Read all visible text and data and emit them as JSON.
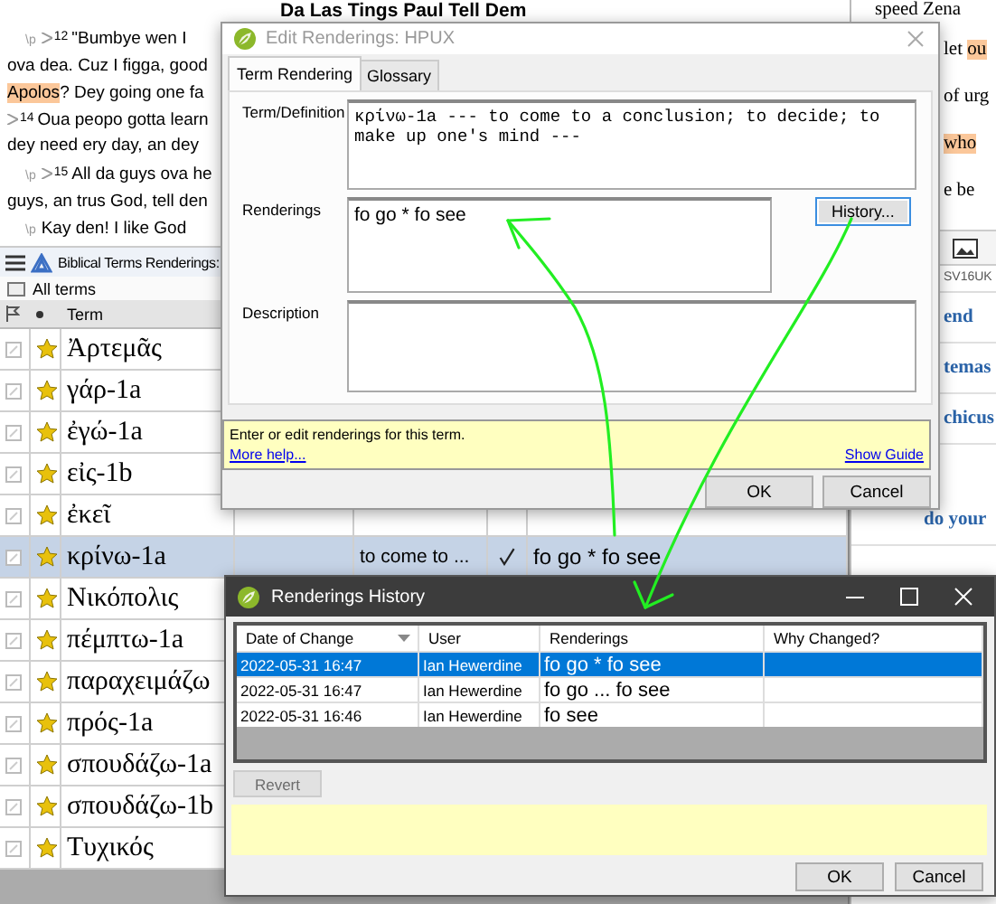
{
  "scripture": {
    "heading": "Da Las Tings Paul Tell Dem",
    "lines": [
      {
        "marker": "\\p",
        "verse": "12",
        "parts": [
          {
            "text": "\"Bumbye wen I",
            "highlight": false
          }
        ]
      },
      {
        "parts": [
          {
            "text": "ova dea. Cuz I figga, good",
            "highlight": false
          }
        ]
      },
      {
        "parts": [
          {
            "text": "Apolos",
            "highlight": true
          },
          {
            "text": "? Dey going one fa",
            "highlight": false
          }
        ]
      },
      {
        "verse": "14",
        "parts": [
          {
            "text": "Oua peopo gotta learn",
            "highlight": false
          }
        ]
      },
      {
        "parts": [
          {
            "text": "dey need ery day, an dey",
            "highlight": false
          }
        ]
      },
      {
        "marker": "\\p",
        "verse": "15",
        "parts": [
          {
            "text": "All da guys ova he",
            "highlight": false
          }
        ]
      },
      {
        "parts": [
          {
            "text": "guys, an trus God, tell den",
            "highlight": false
          }
        ]
      },
      {
        "marker": "\\p",
        "parts": [
          {
            "text": "Kay den! I like God",
            "highlight": false
          }
        ]
      }
    ]
  },
  "side_pane": {
    "lines": [
      {
        "parts": [
          {
            "text": "speed Zena",
            "highlight": false
          }
        ]
      },
      {
        "parts": [
          {
            "text": "let ",
            "highlight": false
          },
          {
            "text": "ou",
            "highlight": true
          }
        ]
      },
      {
        "parts": [
          {
            "text": "of urg",
            "highlight": false
          }
        ]
      },
      {
        "parts": [
          {
            "text": "who",
            "highlight": true
          }
        ]
      },
      {
        "parts": [
          {
            "text": "e be",
            "highlight": false
          }
        ]
      }
    ],
    "reference": "SV16UK",
    "links": [
      "end",
      "temas",
      "chicus",
      "do your"
    ]
  },
  "terms_panel": {
    "title": "Biblical Terms Renderings:",
    "filter": "All terms",
    "column_term": "Term",
    "rows": [
      {
        "term": "Ἀρτεμᾶς",
        "selected": false
      },
      {
        "term": "γάρ-1a",
        "selected": false
      },
      {
        "term": "ἐγώ-1a",
        "selected": false
      },
      {
        "term": "εἰς-1b",
        "selected": false
      },
      {
        "term": "ἐκεῖ",
        "selected": false
      },
      {
        "term": "κρίνω-1a",
        "selected": true,
        "gloss": "to come to ...",
        "checked": true,
        "renderings": "fo go * fo see"
      },
      {
        "term": "Νικόπολις",
        "selected": false
      },
      {
        "term": "πέμπτω-1a",
        "selected": false
      },
      {
        "term": "παραχειμάζω",
        "selected": false
      },
      {
        "term": "πρός-1a",
        "selected": false
      },
      {
        "term": "σπουδάζω-1a",
        "selected": false
      },
      {
        "term": "σπουδάζω-1b",
        "selected": false
      },
      {
        "term": "Τυχικός",
        "selected": false
      }
    ]
  },
  "edit_dialog": {
    "title": "Edit Renderings: HPUX",
    "tabs": [
      {
        "label": "Term Rendering",
        "selected": true
      },
      {
        "label": "Glossary",
        "selected": false
      }
    ],
    "term_label": "Term/Definition",
    "term_value": "κρίνω-1a --- to come to a conclusion; to decide; to make up one's mind ---",
    "renderings_label": "Renderings",
    "renderings_value": "fo go * fo see",
    "history_button": "History...",
    "description_label": "Description",
    "help_text": "Enter or edit renderings for this term.",
    "more_help": "More help...",
    "show_guide": "Show Guide",
    "buttons": [
      "OK",
      "Cancel"
    ]
  },
  "history_dialog": {
    "title": "Renderings History",
    "columns": [
      "Date of Change",
      "User",
      "Renderings",
      "Why Changed?"
    ],
    "rows": [
      {
        "date": "2022-05-31 16:47",
        "user": "Ian Hewerdine",
        "renderings": "fo go * fo see",
        "selected": true
      },
      {
        "date": "2022-05-31 16:47",
        "user": "Ian Hewerdine",
        "renderings": "fo go ... fo see",
        "selected": false
      },
      {
        "date": "2022-05-31 16:46",
        "user": "Ian Hewerdine",
        "renderings": "fo see",
        "selected": false
      }
    ],
    "revert": {
      "label": "Revert",
      "disabled": true
    },
    "buttons": [
      "OK",
      "Cancel"
    ]
  }
}
